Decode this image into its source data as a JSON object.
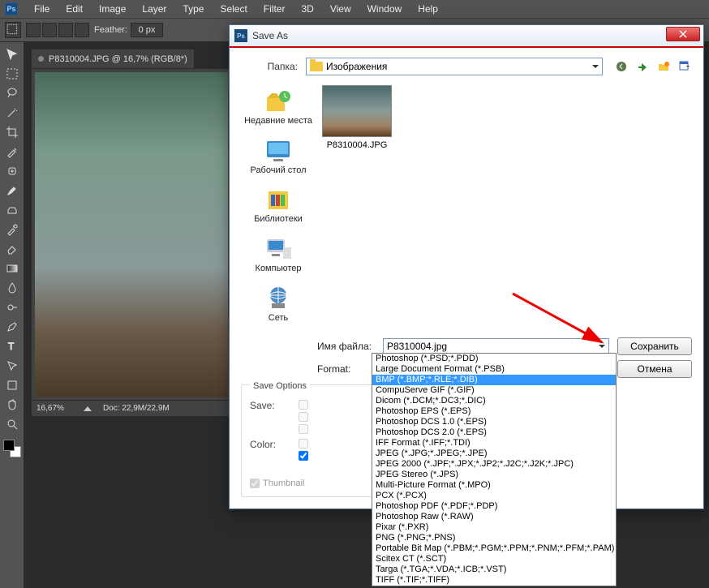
{
  "menubar": [
    "File",
    "Edit",
    "Image",
    "Layer",
    "Type",
    "Select",
    "Filter",
    "3D",
    "View",
    "Window",
    "Help"
  ],
  "optionbar": {
    "feather_label": "Feather:",
    "feather_value": "0 px"
  },
  "doc_tab": "P8310004.JPG @ 16,7% (RGB/8*)",
  "statusbar": {
    "zoom": "16,67%",
    "doc": "Doc: 22,9M/22,9M"
  },
  "tools": [
    "move",
    "rect-marquee",
    "lasso",
    "magic-wand",
    "crop",
    "eyedropper",
    "healing",
    "brush",
    "clone",
    "history-brush",
    "eraser",
    "gradient",
    "blur",
    "dodge",
    "pen",
    "type",
    "path-select",
    "rectangle",
    "hand",
    "zoom"
  ],
  "dialog": {
    "title": "Save As",
    "folder_label": "Папка:",
    "folder_value": "Изображения",
    "places": [
      {
        "id": "recent",
        "label": "Недавние места"
      },
      {
        "id": "desktop",
        "label": "Рабочий стол"
      },
      {
        "id": "libraries",
        "label": "Библиотеки"
      },
      {
        "id": "computer",
        "label": "Компьютер"
      },
      {
        "id": "network",
        "label": "Сеть"
      }
    ],
    "thumb_name": "P8310004.JPG",
    "filename_label": "Имя файла:",
    "filename_value": "P8310004.jpg",
    "format_label": "Format:",
    "format_value": "JPEG (*.JPG;*.JPEG;*.JPE)",
    "save_btn": "Сохранить",
    "cancel_btn": "Отмена",
    "save_options_hdr": "Save Options",
    "save_label": "Save:",
    "color_label": "Color:",
    "thumbnail_label": "Thumbnail"
  },
  "formats": [
    "Photoshop (*.PSD;*.PDD)",
    "Large Document Format (*.PSB)",
    "BMP (*.BMP;*.RLE;*.DIB)",
    "CompuServe GIF (*.GIF)",
    "Dicom (*.DCM;*.DC3;*.DIC)",
    "Photoshop EPS (*.EPS)",
    "Photoshop DCS 1.0 (*.EPS)",
    "Photoshop DCS 2.0 (*.EPS)",
    "IFF Format (*.IFF;*.TDI)",
    "JPEG (*.JPG;*.JPEG;*.JPE)",
    "JPEG 2000 (*.JPF;*.JPX;*.JP2;*.J2C;*.J2K;*.JPC)",
    "JPEG Stereo (*.JPS)",
    "Multi-Picture Format (*.MPO)",
    "PCX (*.PCX)",
    "Photoshop PDF (*.PDF;*.PDP)",
    "Photoshop Raw (*.RAW)",
    "Pixar (*.PXR)",
    "PNG (*.PNG;*.PNS)",
    "Portable Bit Map (*.PBM;*.PGM;*.PPM;*.PNM;*.PFM;*.PAM)",
    "Scitex CT (*.SCT)",
    "Targa (*.TGA;*.VDA;*.ICB;*.VST)",
    "TIFF (*.TIF;*.TIFF)"
  ],
  "selected_format_index": 2
}
